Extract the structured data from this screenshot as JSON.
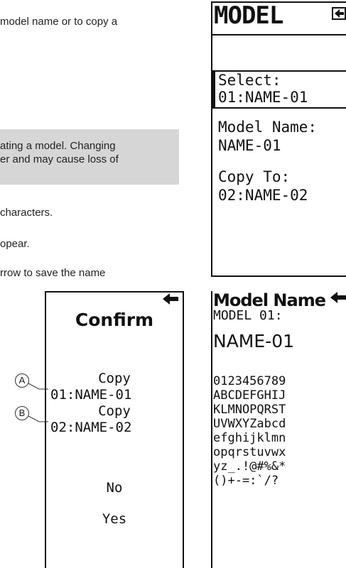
{
  "manual": {
    "line1": "model name or to copy a",
    "note1": "ating a model. Changing",
    "note2": "er and may cause loss of",
    "line_chars": "characters.",
    "line_appear": "opear.",
    "line_save": "rrow to save the name"
  },
  "screen_model": {
    "title": "MODEL",
    "select_label": "Select:",
    "select_value": "01:NAME-01",
    "name_label": "Model Name:",
    "name_value": "NAME-01",
    "copy_label": "Copy To:",
    "copy_value": "02:NAME-02"
  },
  "screen_confirm": {
    "title": "Confirm",
    "copy1_label": "Copy",
    "copy1_value": "01:NAME-01",
    "copy2_label": "Copy",
    "copy2_value": "02:NAME-02",
    "no": "No",
    "yes": "Yes",
    "callout_a": "A",
    "callout_b": "B"
  },
  "screen_name": {
    "title": "Model Name",
    "model_label": "MODEL 01:",
    "name_value": "NAME-01",
    "charset": [
      "0123456789",
      "ABCDEFGHIJ",
      "KLMNOPQRST",
      "UVWXYZabcd",
      "efghijklmn",
      "opqrstuvwx",
      "yz_.!@#%&*",
      "()+-=:`/?"
    ]
  },
  "icons": {
    "back": "back-arrow-icon"
  }
}
